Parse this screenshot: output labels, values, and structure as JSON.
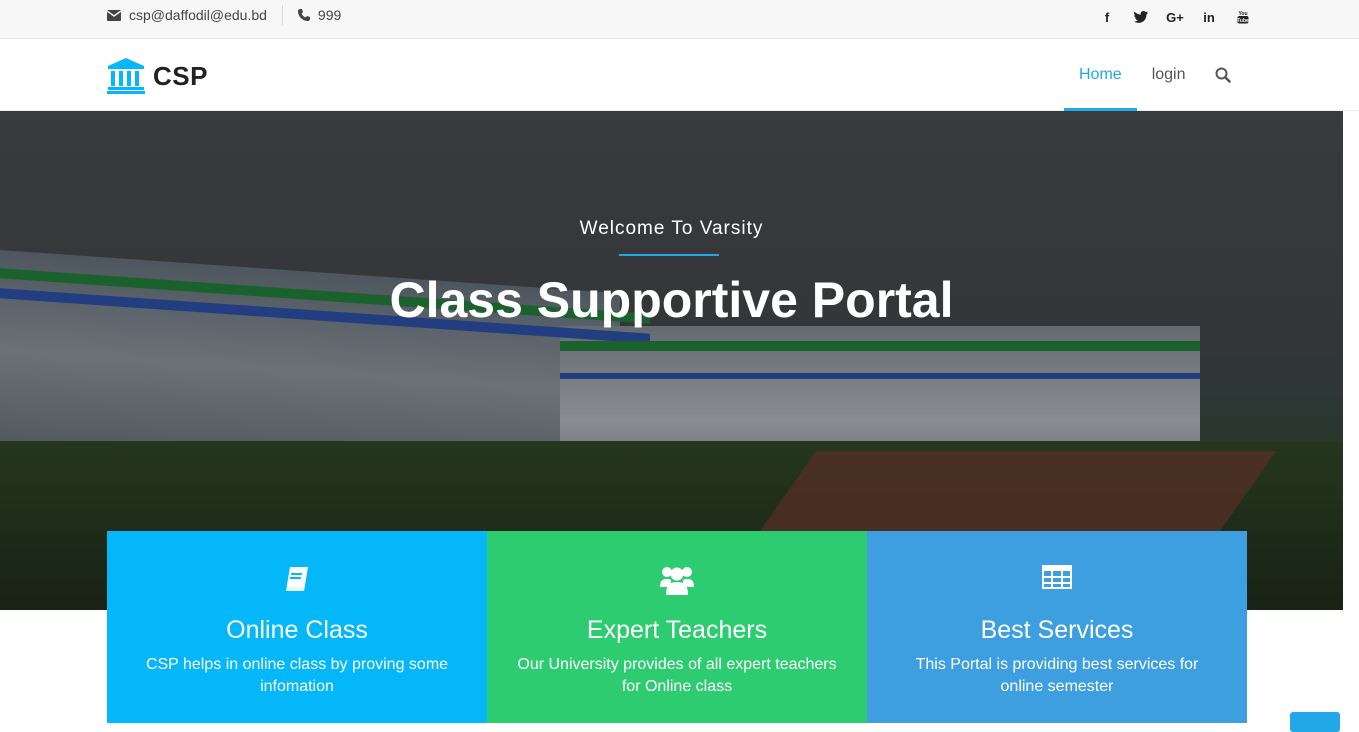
{
  "topbar": {
    "email": "csp@daffodil@edu.bd",
    "phone": "999",
    "social": [
      {
        "icon": "facebook-icon",
        "glyph": "f"
      },
      {
        "icon": "twitter-icon",
        "glyph": "🐦"
      },
      {
        "icon": "google-plus-icon",
        "glyph": "G+"
      },
      {
        "icon": "linkedin-icon",
        "glyph": "in"
      },
      {
        "icon": "youtube-icon",
        "glyph": "You"
      }
    ]
  },
  "header": {
    "brand": "CSP",
    "nav": {
      "home": "Home",
      "login": "login"
    }
  },
  "hero": {
    "welcome": "Welcome To Varsity",
    "title": "Class Supportive Portal"
  },
  "features": [
    {
      "title": "Online Class",
      "description": "CSP helps in online class by proving some infomation",
      "color": "#04b7f8",
      "icon": "book-icon"
    },
    {
      "title": "Expert Teachers",
      "description": "Our University provides of all expert teachers for Online class",
      "color": "#2ecc71",
      "icon": "users-icon"
    },
    {
      "title": "Best Services",
      "description": "This Portal is providing best services for online semester",
      "color": "#3d9ee0",
      "icon": "table-icon"
    }
  ],
  "colors": {
    "accent": "#22a7e8"
  }
}
